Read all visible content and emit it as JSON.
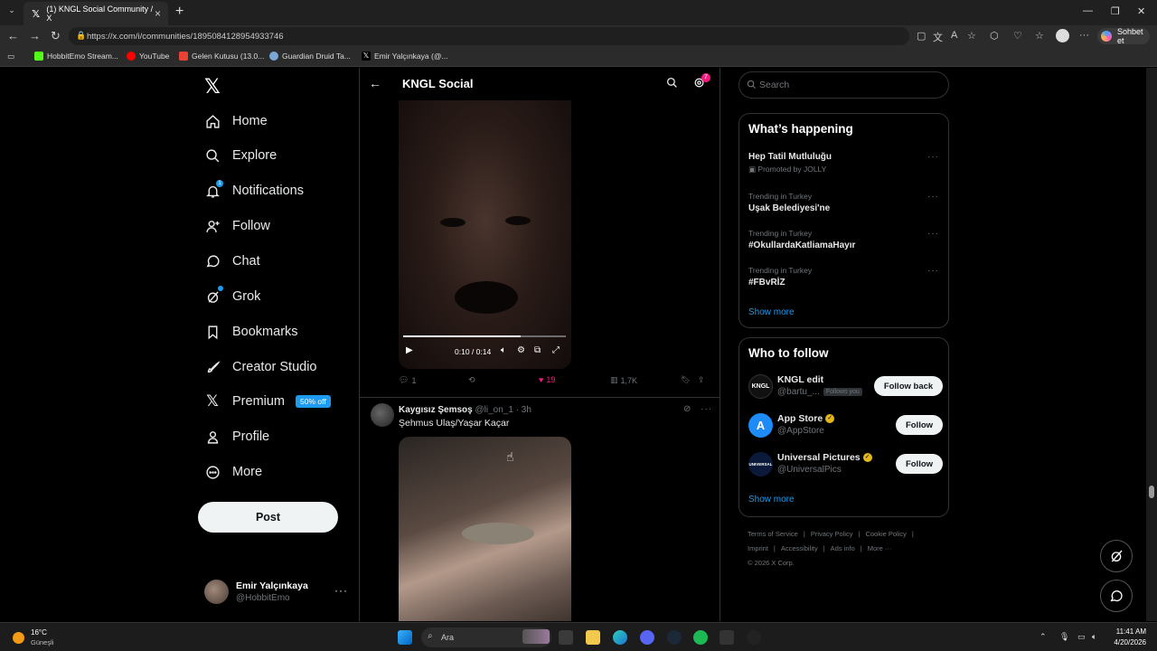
{
  "browser": {
    "tab_title": "(1) KNGL Social Community / X",
    "url": "https://x.com/i/communities/1895084128954933746",
    "copilot_label": "Sohbet et",
    "bookmarks": [
      "HobbitEmo Stream...",
      "YouTube",
      "Gelen Kutusu (13.0...",
      "Guardian Druid Ta...",
      "Emir Yalçınkaya (@..."
    ]
  },
  "nav": {
    "items": [
      "Home",
      "Explore",
      "Notifications",
      "Follow",
      "Chat",
      "Grok",
      "Bookmarks",
      "Creator Studio",
      "Premium",
      "Profile",
      "More"
    ],
    "notifications_count": "1",
    "premium_badge": "50% off",
    "post_label": "Post",
    "user_name": "Emir Yalçınkaya",
    "user_handle": "@HobbitEmo"
  },
  "center": {
    "title": "KNGL Social",
    "settings_badge": "7",
    "tweet1": {
      "video_time": "0:10 / 0:14",
      "video_progress": 0.72,
      "replies": "1",
      "likes": "19",
      "views": "1,7K"
    },
    "tweet2": {
      "name": "Kaygısız Şemsoş",
      "handle": "@li_on_1",
      "time": "· 3h",
      "text": "Şehmus Ulaş/Yaşar Kaçar"
    }
  },
  "right": {
    "search_placeholder": "Search",
    "whats_happening_title": "What’s happening",
    "trends": [
      {
        "meta": "Promoted by JOLLY",
        "title": "Hep Tatil Mutluluğu",
        "promoted": true
      },
      {
        "meta": "Trending in Turkey",
        "title": "Uşak Belediyesi'ne"
      },
      {
        "meta": "Trending in Turkey",
        "title": "#OkullardaKatliamaHayır"
      },
      {
        "meta": "Trending in Turkey",
        "title": "#FBvRİZ"
      }
    ],
    "show_more": "Show more",
    "who_to_follow_title": "Who to follow",
    "follow_suggestions": [
      {
        "name": "KNGL edit",
        "handle": "@bartu_...",
        "follows_you": "Follows you",
        "button": "Follow back",
        "avatar_text": "KNGL"
      },
      {
        "name": "App Store",
        "handle": "@AppStore",
        "button": "Follow",
        "verified": true
      },
      {
        "name": "Universal Pictures",
        "handle": "@UniversalPics",
        "button": "Follow",
        "verified": true,
        "avatar_text": "UNIVERSAL"
      }
    ],
    "footer_links": [
      "Terms of Service",
      "|",
      "Privacy Policy",
      "|",
      "Cookie Policy",
      "|",
      "Imprint",
      "|",
      "Accessibility",
      "|",
      "Ads info",
      "|",
      "More ···"
    ],
    "copyright": "© 2026 X Corp."
  },
  "taskbar": {
    "temperature": "16°C",
    "weather": "Güneşli",
    "search_placeholder": "Ara",
    "time": "11:41 AM",
    "date": "4/20/2026"
  },
  "colors": {
    "accent": "#1d9bf0",
    "like": "#f91880",
    "background": "#000000"
  }
}
